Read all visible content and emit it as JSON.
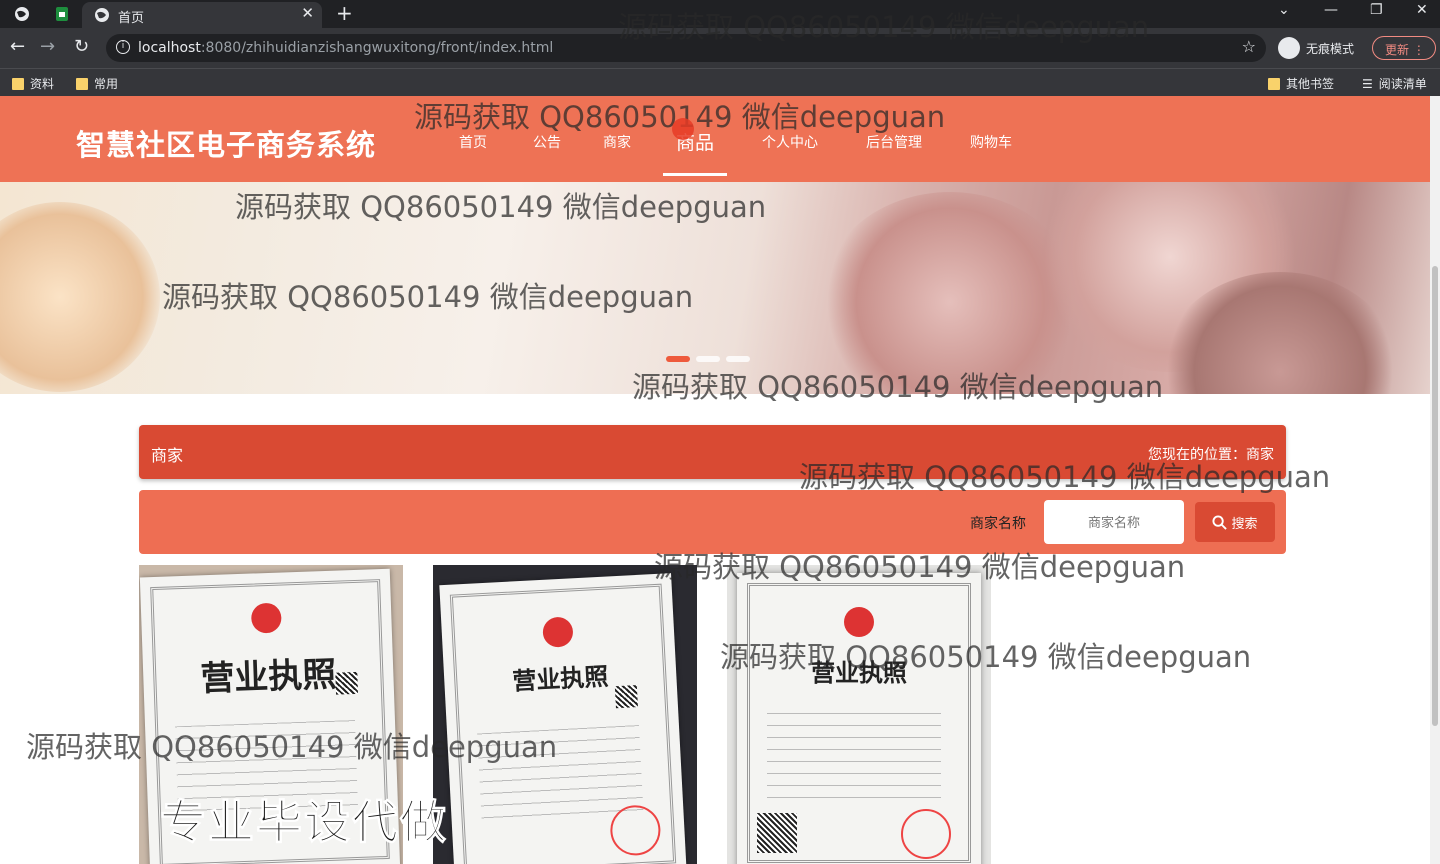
{
  "browser": {
    "tab_title": "首页",
    "url_host": "localhost",
    "url_path": ":8080/zhihuidianzishangwuxitong/front/index.html",
    "incognito_label": "无痕模式",
    "update_label": "更新",
    "bookmarks": [
      "资料",
      "常用"
    ],
    "bookmarks_right": [
      "其他书签",
      "阅读清单"
    ]
  },
  "site": {
    "logo": "智慧社区电子商务系统",
    "nav": [
      "首页",
      "公告",
      "商家",
      "商品",
      "个人中心",
      "后台管理",
      "购物车"
    ],
    "active_nav": "商品"
  },
  "breadcrumb": {
    "title": "商家",
    "position": "您现在的位置：商家"
  },
  "search": {
    "label": "商家名称",
    "placeholder": "商家名称",
    "button": "搜索"
  },
  "promo": "专业毕设代做",
  "watermark": "源码获取 QQ86050149 微信deepguan",
  "license_cards": [
    {
      "title": "营业执照"
    },
    {
      "title": "营业执照"
    },
    {
      "title": "营业执照"
    }
  ],
  "colors": {
    "header": "#ee7255",
    "crumb": "#d94a33",
    "search_bar": "#ee6e53"
  }
}
